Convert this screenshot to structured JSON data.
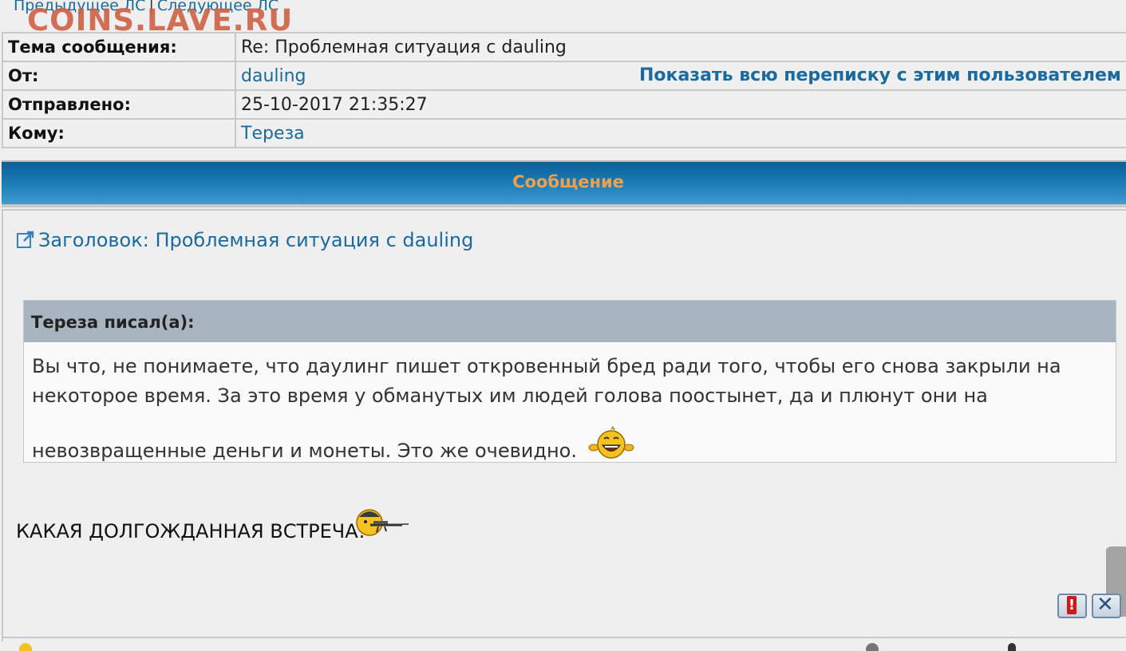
{
  "nav": {
    "prev": "Предыдущее ЛС",
    "separator": "|",
    "next": "Следующее ЛС"
  },
  "watermark": "COINS.LAVE.RU",
  "header": {
    "subject_label": "Тема сообщения:",
    "subject_value": "Re: Проблемная ситуация с dauling",
    "from_label": "От:",
    "from_value": "dauling",
    "show_all": "Показать всю переписку с этим пользователем",
    "sent_label": "Отправлено:",
    "sent_value": "25-10-2017 21:35:27",
    "to_label": "Кому:",
    "to_value": "Тереза"
  },
  "message": {
    "band_title": "Сообщение",
    "title": "Заголовок: Проблемная ситуация с dauling",
    "quote_author": "Тереза писал(а):",
    "quote_line1": "Вы что, не понимаете, что даулинг пишет откровенный бред ради того, чтобы его снова закрыли на",
    "quote_line2": "некоторое время. За это время у обманутых им людей голова поостынет, да и плюнут они на",
    "quote_line3": "невозвращенные деньги и монеты. Это же очевидно.",
    "reply": "КАКАЯ ДОЛГОЖДАННАЯ ВСТРЕЧА!"
  },
  "actions": {
    "report_glyph": "!",
    "close_glyph": "✕"
  },
  "icons": {
    "subject": "external-link-icon",
    "smile_quote": "laughing-smiley-icon",
    "smile_reply": "sniper-smiley-icon"
  },
  "colors": {
    "link": "#1a6aa0",
    "band": "#0a5f97",
    "band_title": "#f0a04a",
    "quote_header": "#a8b5c1"
  }
}
